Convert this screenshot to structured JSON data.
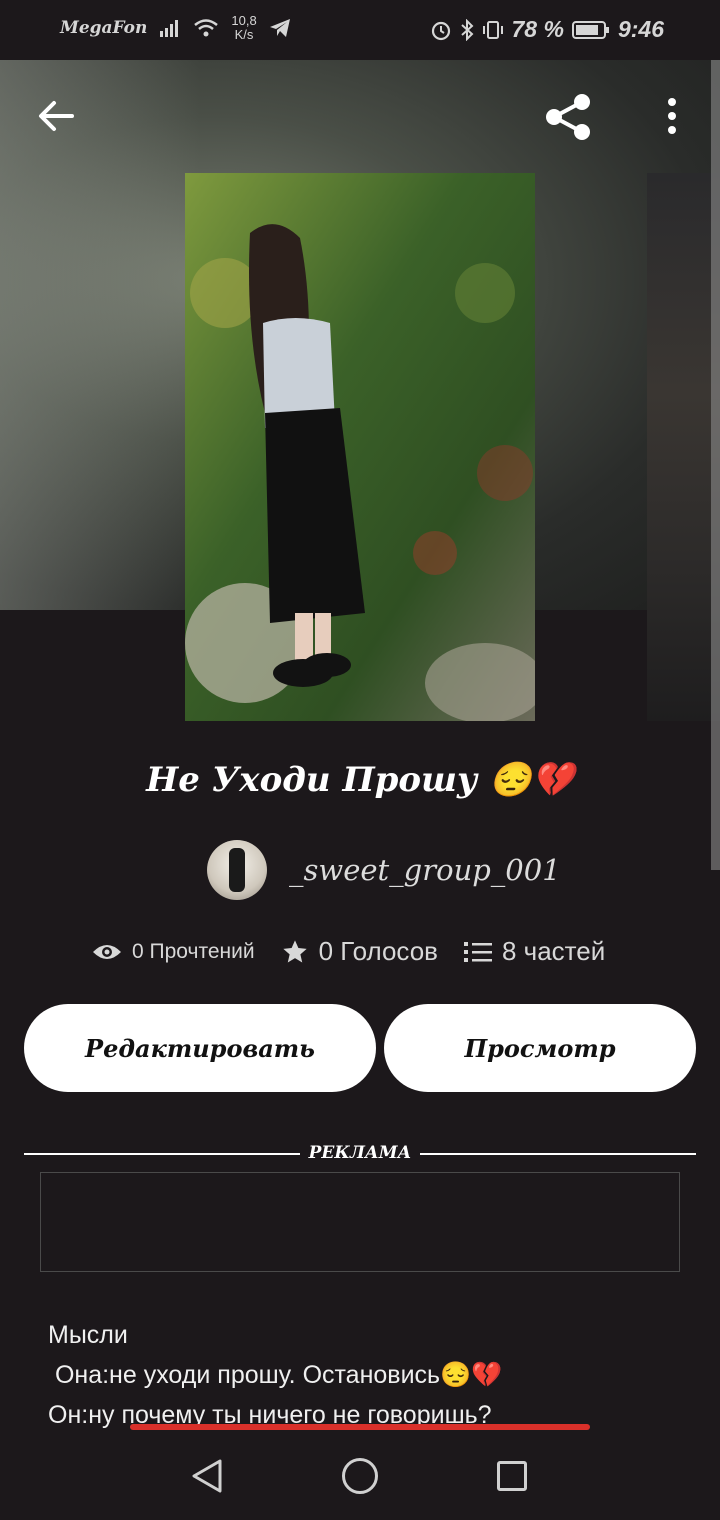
{
  "status_bar": {
    "carrier": "MegaFon",
    "net_speed_value": "10,8",
    "net_speed_unit": "K/s",
    "battery": "78 %",
    "time": "9:46"
  },
  "book": {
    "title": "Не Уходи Прошу 😔💔",
    "author": "_sweet_group_001"
  },
  "stats": {
    "reads": "0 Прочтений",
    "votes": "0 Голосов",
    "parts": "8 частей"
  },
  "actions": {
    "edit_label": "Редактировать",
    "view_label": "Просмотр"
  },
  "ad": {
    "label": "РЕКЛАМА"
  },
  "story_lines": [
    "Мысли",
    " Она:не уходи прошу. Остановись😔💔",
    "Он:ну почему ты ничего не говоришь?"
  ],
  "colors": {
    "background": "#1c181b",
    "button_bg": "#ffffff",
    "underline": "#d9302a"
  },
  "icons": {
    "back": "arrow-left-icon",
    "share": "share-icon",
    "more": "more-vert-icon",
    "reads": "eye-icon",
    "votes": "star-icon",
    "parts": "list-icon"
  }
}
